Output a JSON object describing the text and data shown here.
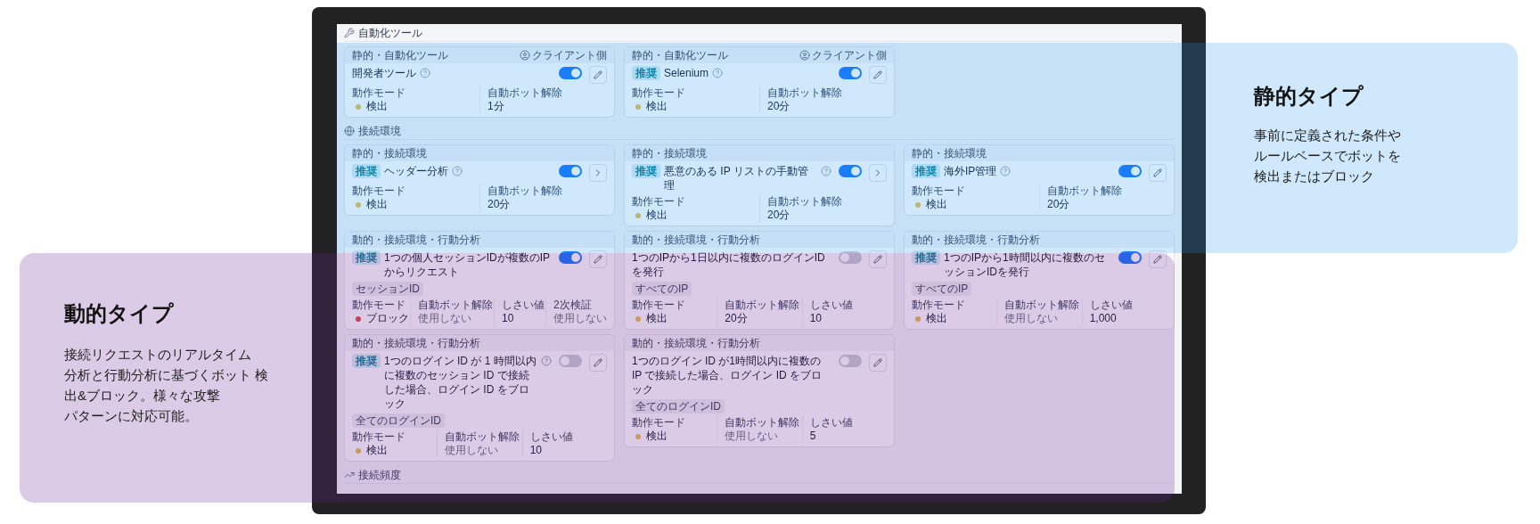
{
  "sections": [
    {
      "label": "自動化ツール",
      "cards": [
        {
          "category": "静的・自動化ツール",
          "side": "クライアント側",
          "recommended": false,
          "title": "開発者ツール",
          "help": true,
          "on": true,
          "kind": "edit",
          "fields": [
            {
              "kind": "mode",
              "label": "動作モード",
              "value": "検出",
              "blocking": false
            },
            {
              "kind": "value",
              "label": "自動ボット解除",
              "value": "1分",
              "dimmed": false
            }
          ]
        },
        {
          "category": "静的・自動化ツール",
          "side": "クライアント側",
          "recommended": true,
          "badge": "推奨",
          "title": "Selenium",
          "help": true,
          "on": true,
          "kind": "edit",
          "fields": [
            {
              "kind": "mode",
              "label": "動作モード",
              "value": "検出",
              "blocking": false
            },
            {
              "kind": "value",
              "label": "自動ボット解除",
              "value": "20分",
              "dimmed": false
            }
          ]
        }
      ]
    },
    {
      "label": "接続環境",
      "cards": [
        {
          "category": "静的・接続環境",
          "recommended": true,
          "badge": "推奨",
          "title": "ヘッダー分析",
          "help": true,
          "on": true,
          "kind": "open",
          "fields": [
            {
              "kind": "mode",
              "label": "動作モード",
              "value": "検出",
              "blocking": false
            },
            {
              "kind": "value",
              "label": "自動ボット解除",
              "value": "20分",
              "dimmed": false
            }
          ]
        },
        {
          "category": "静的・接続環境",
          "recommended": true,
          "badge": "推奨",
          "title": "悪意のある IP リストの手動管理",
          "help": true,
          "on": true,
          "kind": "open",
          "fields": [
            {
              "kind": "mode",
              "label": "動作モード",
              "value": "検出",
              "blocking": false
            },
            {
              "kind": "value",
              "label": "自動ボット解除",
              "value": "20分",
              "dimmed": false
            }
          ]
        },
        {
          "category": "静的・接続環境",
          "recommended": true,
          "badge": "推奨",
          "title": "海外IP管理",
          "help": true,
          "on": true,
          "kind": "edit",
          "fields": [
            {
              "kind": "mode",
              "label": "動作モード",
              "value": "検出",
              "blocking": false
            },
            {
              "kind": "value",
              "label": "自動ボット解除",
              "value": "20分",
              "dimmed": false
            }
          ]
        },
        {
          "category": "動的・接続環境・行動分析",
          "recommended": true,
          "badge": "推奨",
          "title": "1つの個人セッションIDが複数のIPからリクエスト",
          "help": false,
          "tag": "セッションID",
          "on": true,
          "kind": "edit",
          "fields": [
            {
              "kind": "mode",
              "label": "動作モード",
              "value": "ブロック",
              "blocking": true
            },
            {
              "kind": "value",
              "label": "自動ボット解除",
              "value": "使用しない",
              "dimmed": true
            },
            {
              "kind": "value",
              "label": "しさい値",
              "value": "10",
              "dimmed": false
            },
            {
              "kind": "value",
              "label": "2次検証",
              "value": "使用しない",
              "dimmed": true
            }
          ]
        },
        {
          "category": "動的・接続環境・行動分析",
          "recommended": false,
          "title": "1つのIPから1日以内に複数のログインIDを発行",
          "help": false,
          "tag": "すべてのIP",
          "on": false,
          "kind": "edit",
          "fields": [
            {
              "kind": "mode",
              "label": "動作モード",
              "value": "検出",
              "blocking": false
            },
            {
              "kind": "value",
              "label": "自動ボット解除",
              "value": "20分",
              "dimmed": false
            },
            {
              "kind": "value",
              "label": "しさい値",
              "value": "10",
              "dimmed": false
            }
          ]
        },
        {
          "category": "動的・接続環境・行動分析",
          "recommended": true,
          "badge": "推奨",
          "title": "1つのIPから1時間以内に複数のセッションIDを発行",
          "help": false,
          "tag": "すべてのIP",
          "on": true,
          "kind": "edit",
          "fields": [
            {
              "kind": "mode",
              "label": "動作モード",
              "value": "検出",
              "blocking": false
            },
            {
              "kind": "value",
              "label": "自動ボット解除",
              "value": "使用しない",
              "dimmed": true
            },
            {
              "kind": "value",
              "label": "しさい値",
              "value": "1,000",
              "dimmed": false
            }
          ]
        },
        {
          "category": "動的・接続環境・行動分析",
          "recommended": true,
          "badge": "推奨",
          "title": "1つのログイン ID が 1 時間以内に複数のセッション ID で接続した場合、ログイン ID をブロック",
          "help": true,
          "tag": "全てのログインID",
          "on": false,
          "kind": "edit",
          "fields": [
            {
              "kind": "mode",
              "label": "動作モード",
              "value": "検出",
              "blocking": false
            },
            {
              "kind": "value",
              "label": "自動ボット解除",
              "value": "使用しない",
              "dimmed": true
            },
            {
              "kind": "value",
              "label": "しさい値",
              "value": "10",
              "dimmed": false
            }
          ]
        },
        {
          "category": "動的・接続環境・行動分析",
          "recommended": false,
          "title": "1つのログイン ID が1時間以内に複数の IP で接続した場合、ログイン ID をブロック",
          "help": false,
          "tag": "全てのログインID",
          "on": false,
          "kind": "edit",
          "fields": [
            {
              "kind": "mode",
              "label": "動作モード",
              "value": "検出",
              "blocking": false
            },
            {
              "kind": "value",
              "label": "自動ボット解除",
              "value": "使用しない",
              "dimmed": true
            },
            {
              "kind": "value",
              "label": "しさい値",
              "value": "5",
              "dimmed": false
            }
          ]
        }
      ]
    },
    {
      "label": "接続頻度"
    }
  ],
  "callouts": [
    {
      "kind": "static",
      "title": "静的タイプ",
      "lines": [
        "事前に定義された条件や",
        "ルールベースでボットを",
        "検出またはブロック"
      ]
    },
    {
      "kind": "dynamic",
      "title": "動的タイプ",
      "lines": [
        "接続リクエストのリアルタイム",
        "分析と行動分析に基づくボット 検出&ブロック。様々な攻撃",
        "パターンに対応可能。"
      ]
    }
  ]
}
